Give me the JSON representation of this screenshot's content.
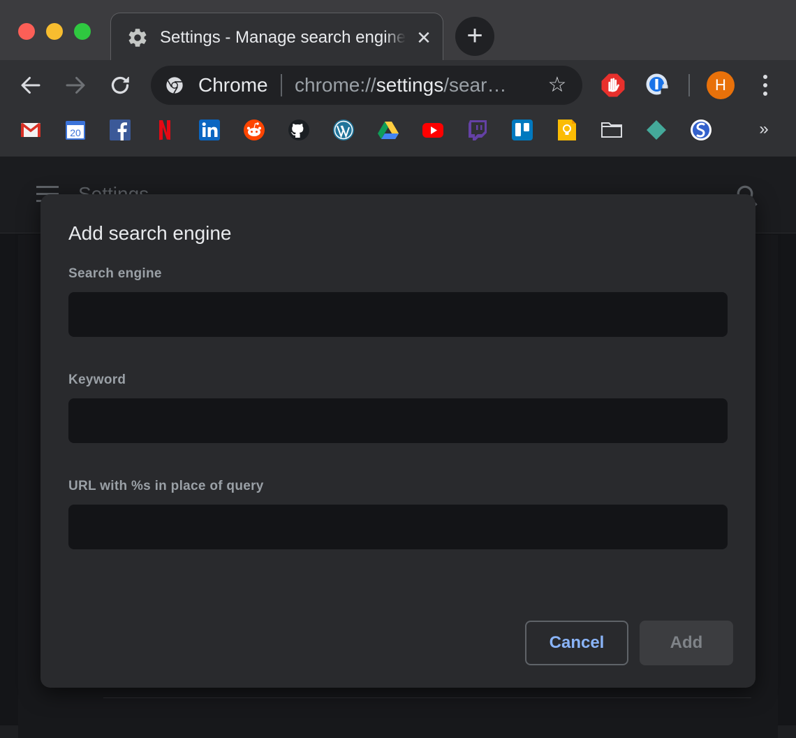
{
  "browser": {
    "tab": {
      "title": "Settings - Manage search engines",
      "close_glyph": "✕",
      "icon": "gear-icon"
    },
    "new_tab_glyph": "+",
    "omnibox": {
      "site_label": "Chrome",
      "url_prefix": "chrome://",
      "url_host": "settings",
      "url_rest": "/sear…"
    },
    "star_glyph": "☆",
    "avatar_letter": "H",
    "bookmarks_more": "»",
    "bookmarks": [
      "gmail-icon",
      "google-calendar-icon",
      "facebook-icon",
      "netflix-icon",
      "linkedin-icon",
      "reddit-icon",
      "github-icon",
      "wordpress-icon",
      "google-drive-icon",
      "youtube-icon",
      "twitch-icon",
      "trello-icon",
      "google-keep-icon",
      "folder-icon",
      "sketch-icon",
      "simplenote-icon"
    ],
    "calendar_day": "20",
    "colors": {
      "accent": "#8ab4f8",
      "avatar": "#e8710a"
    }
  },
  "page": {
    "title": "Settings"
  },
  "dialog": {
    "title": "Add search engine",
    "fields": [
      {
        "label": "Search engine",
        "value": "",
        "placeholder": ""
      },
      {
        "label": "Keyword",
        "value": "",
        "placeholder": ""
      },
      {
        "label": "URL with %s in place of query",
        "value": "",
        "placeholder": ""
      }
    ],
    "cancel_label": "Cancel",
    "add_label": "Add"
  }
}
